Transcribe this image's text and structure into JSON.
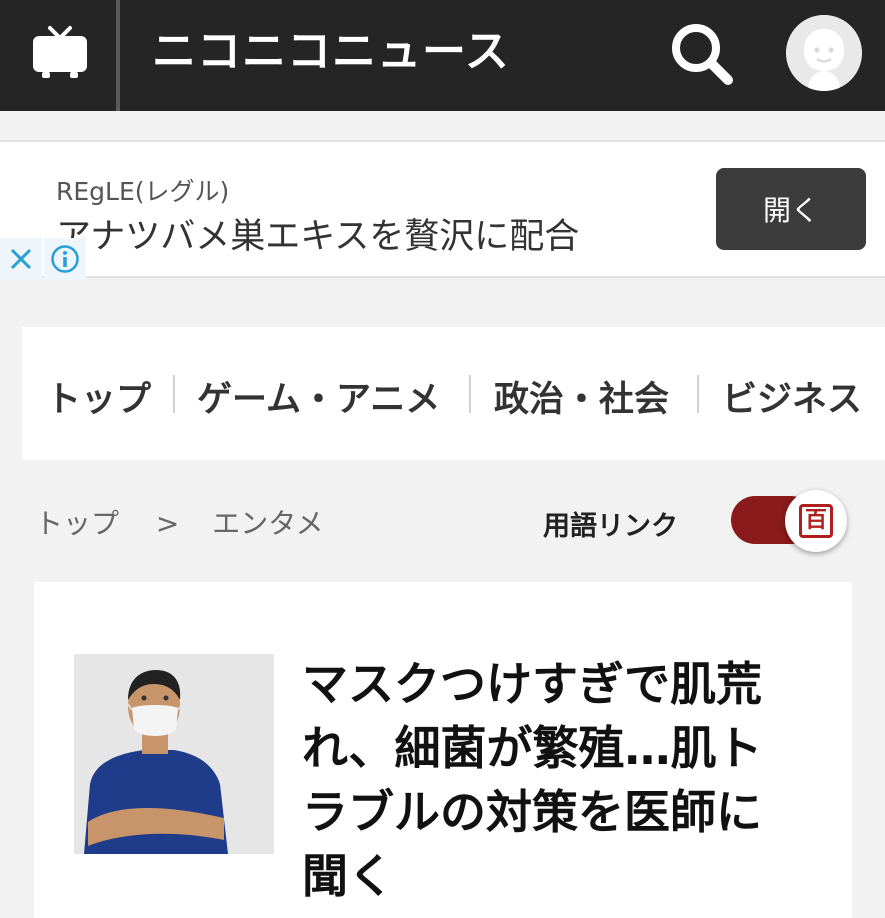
{
  "header": {
    "tv_icon": "tv-icon",
    "logo_text": "ニコニコニュース",
    "search_icon": "search-icon",
    "avatar_icon": "user-avatar-icon"
  },
  "ad": {
    "brand": "REgLE(レグル)",
    "text": "アナツバメ巣エキスを贅沢に配合",
    "open_label": "開く",
    "close_icon": "close-icon",
    "info_icon": "info-icon"
  },
  "categories": [
    {
      "label": "トップ"
    },
    {
      "label": "ゲーム・アニメ"
    },
    {
      "label": "政治・社会"
    },
    {
      "label": "ビジネス"
    }
  ],
  "breadcrumb": {
    "items": [
      "トップ",
      "エンタメ"
    ],
    "separator": ">"
  },
  "term_link": {
    "label": "用語リンク",
    "toggle_on": true,
    "badge": "百"
  },
  "article": {
    "headline": "マスクつけすぎで肌荒れ、細菌が繁殖…肌トラブルの対策を医師に聞く"
  },
  "colors": {
    "header_bg": "#252525",
    "toggle_on": "#8b1a1a",
    "accent_red": "#b01e1e",
    "ad_info": "#2a9fd6"
  }
}
